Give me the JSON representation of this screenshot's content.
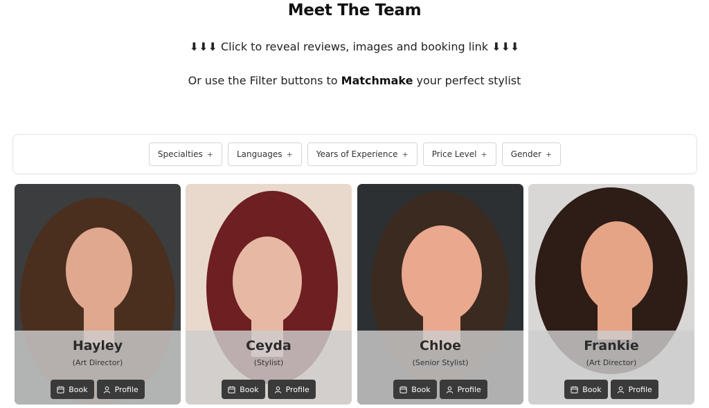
{
  "header": {
    "title": "Meet The Team",
    "reveal_text": "⬇⬇⬇ Click to reveal reviews, images and booking link ⬇⬇⬇",
    "filter_pre": "Or use the Filter buttons to ",
    "filter_bold": "Matchmake",
    "filter_post": " your perfect stylist"
  },
  "filters": [
    {
      "label": "Specialties",
      "icon": "plus-icon"
    },
    {
      "label": "Languages",
      "icon": "plus-icon"
    },
    {
      "label": "Years of Experience",
      "icon": "plus-icon"
    },
    {
      "label": "Price Level",
      "icon": "plus-icon"
    },
    {
      "label": "Gender",
      "icon": "plus-icon"
    }
  ],
  "buttons": {
    "book_label": "Book",
    "book_icon": "calendar-icon",
    "profile_label": "Profile",
    "profile_icon": "person-icon"
  },
  "team": [
    {
      "name": "Hayley",
      "role": "(Art Director)",
      "photo_bg": "#3b3d3e",
      "hair": "#4a2f1f",
      "skin": "#e0a88f"
    },
    {
      "name": "Ceyda",
      "role": "(Stylist)",
      "photo_bg": "#e9d9cd",
      "hair": "#6e1f22",
      "skin": "#e7b9a4"
    },
    {
      "name": "Chloe",
      "role": "(Senior Stylist)",
      "photo_bg": "#2c3032",
      "hair": "#3a2a20",
      "skin": "#eaa88e"
    },
    {
      "name": "Frankie",
      "role": "(Art Director)",
      "photo_bg": "#d9d7d6",
      "hair": "#2e1c16",
      "skin": "#e5a486"
    }
  ]
}
